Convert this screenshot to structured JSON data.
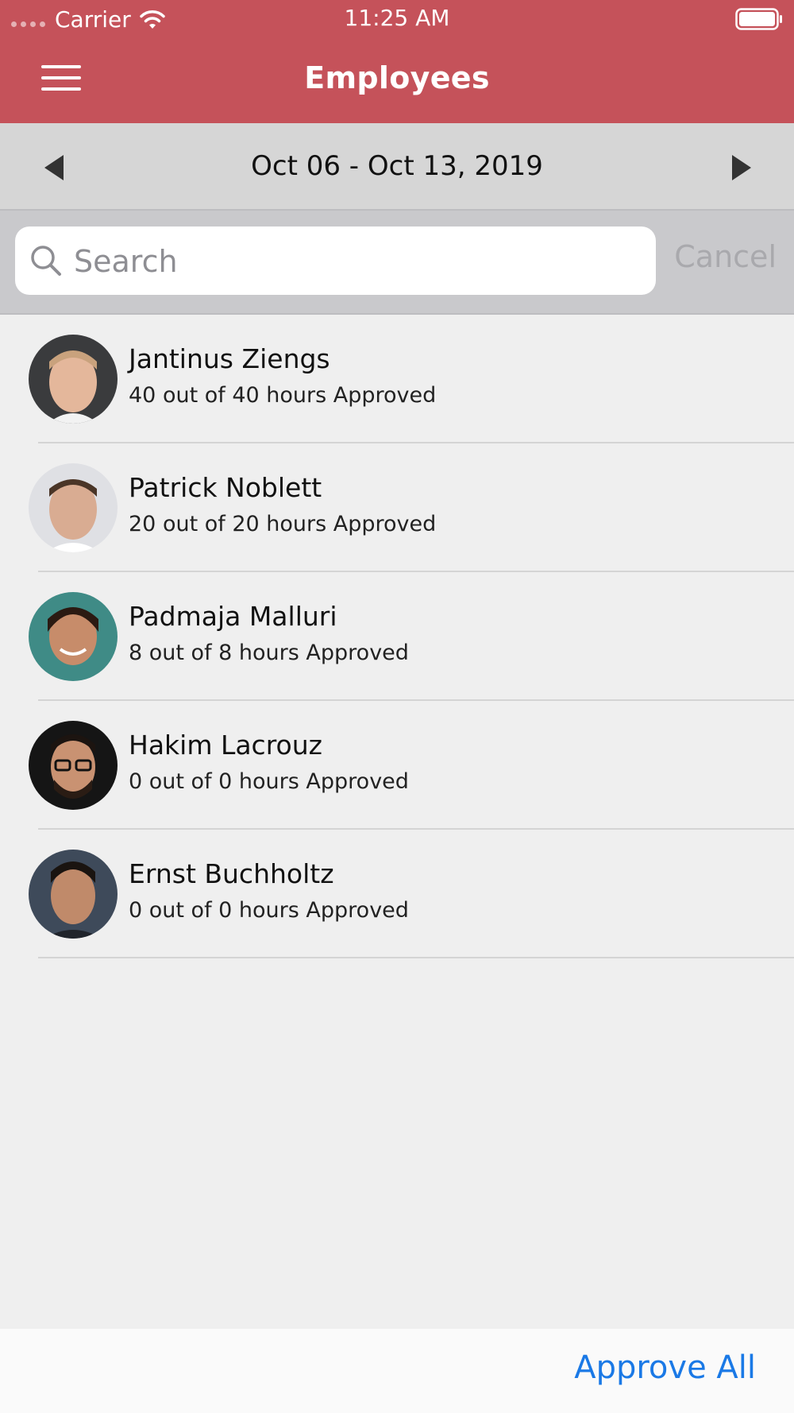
{
  "status_bar": {
    "carrier": "Carrier",
    "time": "11:25 AM"
  },
  "header": {
    "title": "Employees",
    "color": "#c5525a"
  },
  "date_nav": {
    "range": "Oct 06 - Oct 13, 2019"
  },
  "search": {
    "placeholder": "Search",
    "value": "",
    "cancel_label": "Cancel"
  },
  "employees": [
    {
      "name": "Jantinus Ziengs",
      "hours": "40 out of 40 hours Approved"
    },
    {
      "name": "Patrick Noblett",
      "hours": "20 out of 20 hours Approved"
    },
    {
      "name": "Padmaja Malluri",
      "hours": "8 out of 8 hours Approved"
    },
    {
      "name": "Hakim Lacrouz",
      "hours": "0 out of 0 hours Approved"
    },
    {
      "name": "Ernst Buchholtz",
      "hours": "0 out of 0 hours Approved"
    }
  ],
  "footer": {
    "approve_all_label": "Approve All",
    "accent": "#1a79e6"
  }
}
